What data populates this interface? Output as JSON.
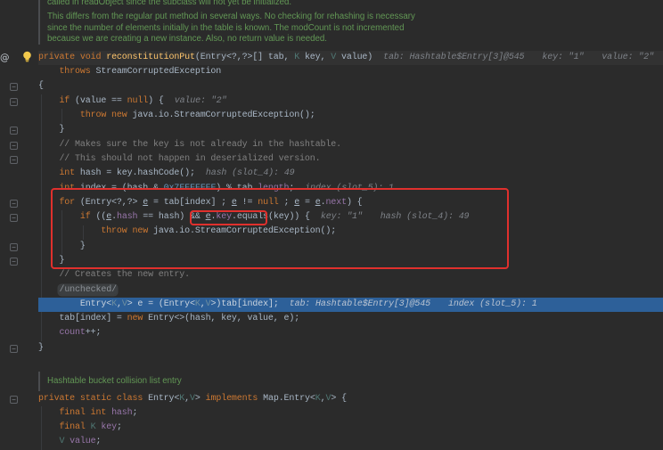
{
  "colors": {
    "background": "#2B2B2B",
    "doc_text": "#629755",
    "inline_value": "#7E8288",
    "inline_value_on_execution_line": "#BAC4D2",
    "execution_line": "#2D6099",
    "caret_line": "#323232",
    "annotation_red": "#E0302D"
  },
  "gutter": {
    "marker": "@",
    "icons": [
      "intention-bulb-icon",
      "fold-icon"
    ]
  },
  "editor": {
    "doc_top": [
      "called in readObject since the subclass will not yet be initialized.",
      "This differs from the regular put method in several ways. No checking for rehashing is necessary",
      "since the number of elements initially in the table is known. The modCount is not incremented",
      "because we are creating a new instance. Also, no return value is needed."
    ],
    "method_lines": [
      {
        "tokens": [
          [
            "private void ",
            "#CC7832"
          ],
          [
            "reconstitutionPut",
            "#FFC66D"
          ],
          [
            "(Entry<?,?>[] tab, ",
            "#A9B7C6"
          ],
          [
            "K",
            "#507874"
          ],
          [
            " key, ",
            "#A9B7C6"
          ],
          [
            "V",
            "#507874"
          ],
          [
            " value)",
            "#A9B7C6"
          ]
        ],
        "hints": [
          "tab: Hashtable$Entry[3]@545",
          "key: \"1\"",
          "value: \"2\""
        ],
        "background": "#323232"
      },
      {
        "tokens": [
          [
            "    throws",
            "#CC7832"
          ],
          [
            " StreamCorruptedException",
            "#A9B7C6"
          ]
        ]
      },
      {
        "tokens": [
          [
            "{",
            "#A9B7C6"
          ]
        ]
      },
      {
        "tokens": [
          [
            "    if",
            "#CC7832"
          ],
          [
            " (value == ",
            "#A9B7C6"
          ],
          [
            "null",
            "#CC7832"
          ],
          [
            ") {",
            "#A9B7C6"
          ]
        ],
        "hints": [
          "value: \"2\""
        ]
      },
      {
        "tokens": [
          [
            "        throw new",
            "#CC7832"
          ],
          [
            " java.io.StreamCorruptedException();",
            "#A9B7C6"
          ]
        ]
      },
      {
        "tokens": [
          [
            "    }",
            "#A9B7C6"
          ]
        ]
      },
      {
        "tokens": [
          [
            "    // Makes sure the key is not already in the hashtable.",
            "#808080"
          ]
        ]
      },
      {
        "tokens": [
          [
            "    // This should not happen in deserialized version.",
            "#808080"
          ]
        ]
      },
      {
        "tokens": [
          [
            "    int",
            "#CC7832"
          ],
          [
            " hash = key.hashCode();",
            "#A9B7C6"
          ]
        ],
        "hints": [
          "hash (slot_4): 49"
        ]
      },
      {
        "tokens": [
          [
            "    int",
            "#CC7832"
          ],
          [
            " index = (hash & ",
            "#A9B7C6"
          ],
          [
            "0x7FFFFFFF",
            "#6897BB"
          ],
          [
            ") % tab.",
            "#A9B7C6"
          ],
          [
            "length",
            "#9876AA"
          ],
          [
            ";",
            "#A9B7C6"
          ]
        ],
        "hints": [
          "index (slot_5): 1"
        ]
      },
      {
        "tokens": [
          [
            "    for",
            "#CC7832"
          ],
          [
            " (Entry<?,?> ",
            "#A9B7C6"
          ],
          [
            "e",
            "#A9B7C6",
            true
          ],
          [
            " = tab[index] ; ",
            "#A9B7C6"
          ],
          [
            "e",
            "#A9B7C6",
            true
          ],
          [
            " != ",
            "#A9B7C6"
          ],
          [
            "null",
            "#CC7832"
          ],
          [
            " ; ",
            "#A9B7C6"
          ],
          [
            "e",
            "#A9B7C6",
            true
          ],
          [
            " = ",
            "#A9B7C6"
          ],
          [
            "e",
            "#A9B7C6",
            true
          ],
          [
            ".",
            "#A9B7C6"
          ],
          [
            "next",
            "#9876AA"
          ],
          [
            ") {",
            "#A9B7C6"
          ]
        ]
      },
      {
        "tokens": [
          [
            "        if",
            "#CC7832"
          ],
          [
            " ((",
            "#A9B7C6"
          ],
          [
            "e",
            "#A9B7C6",
            true
          ],
          [
            ".",
            "#A9B7C6"
          ],
          [
            "hash",
            "#9876AA"
          ],
          [
            " == hash) && ",
            "#A9B7C6"
          ],
          [
            "e",
            "#A9B7C6",
            true
          ],
          [
            ".",
            "#A9B7C6"
          ],
          [
            "key",
            "#9876AA"
          ],
          [
            ".equals(key)) {",
            "#A9B7C6"
          ]
        ],
        "hints": [
          "key: \"1\"",
          "hash (slot_4): 49"
        ]
      },
      {
        "tokens": [
          [
            "            throw new",
            "#CC7832"
          ],
          [
            " java.io.StreamCorruptedException();",
            "#A9B7C6"
          ]
        ]
      },
      {
        "tokens": [
          [
            "        }",
            "#A9B7C6"
          ]
        ]
      },
      {
        "tokens": [
          [
            "    }",
            "#A9B7C6"
          ]
        ]
      },
      {
        "tokens": [
          [
            "    // Creates the new entry.",
            "#808080"
          ]
        ]
      },
      {
        "tokens": [
          [
            "    ",
            "#A9B7C6"
          ],
          [
            "/unchecked/",
            "#8C9096",
            false,
            "#3C3F41"
          ]
        ]
      },
      {
        "tokens": [
          [
            "        Entry<",
            "#C9D3DE"
          ],
          [
            "K",
            "#6E8FA0"
          ],
          [
            ",",
            "#C9D3DE"
          ],
          [
            "V",
            "#6E8FA0"
          ],
          [
            "> e = (Entry<",
            "#C9D3DE"
          ],
          [
            "K",
            "#6E8FA0"
          ],
          [
            ",",
            "#C9D3DE"
          ],
          [
            "V",
            "#6E8FA0"
          ],
          [
            ">)tab[index];",
            "#C9D3DE"
          ]
        ],
        "hints": [
          "tab: Hashtable$Entry[3]@545",
          "index (slot_5): 1"
        ],
        "background": "#2D6099"
      },
      {
        "tokens": [
          [
            "    tab[index] = ",
            "#A9B7C6"
          ],
          [
            "new",
            "#CC7832"
          ],
          [
            " Entry<>(hash, key, value, e);",
            "#A9B7C6"
          ]
        ]
      },
      {
        "tokens": [
          [
            "    count",
            "#9876AA"
          ],
          [
            "++;",
            "#A9B7C6"
          ]
        ]
      },
      {
        "tokens": [
          [
            "}",
            "#A9B7C6"
          ]
        ]
      }
    ],
    "doc_bottom": "Hashtable bucket collision list entry",
    "class_lines": [
      {
        "tokens": [
          [
            "private static class",
            "#CC7832"
          ],
          [
            " Entry<",
            "#A9B7C6"
          ],
          [
            "K",
            "#507874"
          ],
          [
            ",",
            "#A9B7C6"
          ],
          [
            "V",
            "#507874"
          ],
          [
            "> ",
            "#A9B7C6"
          ],
          [
            "implements",
            "#CC7832"
          ],
          [
            " Map.Entry<",
            "#A9B7C6"
          ],
          [
            "K",
            "#507874"
          ],
          [
            ",",
            "#A9B7C6"
          ],
          [
            "V",
            "#507874"
          ],
          [
            "> {",
            "#A9B7C6"
          ]
        ]
      },
      {
        "tokens": [
          [
            "    final int ",
            "#CC7832"
          ],
          [
            "hash",
            "#9876AA"
          ],
          [
            ";",
            "#A9B7C6"
          ]
        ]
      },
      {
        "tokens": [
          [
            "    final ",
            "#CC7832"
          ],
          [
            "K",
            "#507874"
          ],
          [
            " key",
            "#9876AA"
          ],
          [
            ";",
            "#A9B7C6"
          ]
        ]
      },
      {
        "tokens": [
          [
            "    V",
            "#507874"
          ],
          [
            " value",
            "#9876AA"
          ],
          [
            ";",
            "#A9B7C6"
          ]
        ]
      }
    ]
  }
}
